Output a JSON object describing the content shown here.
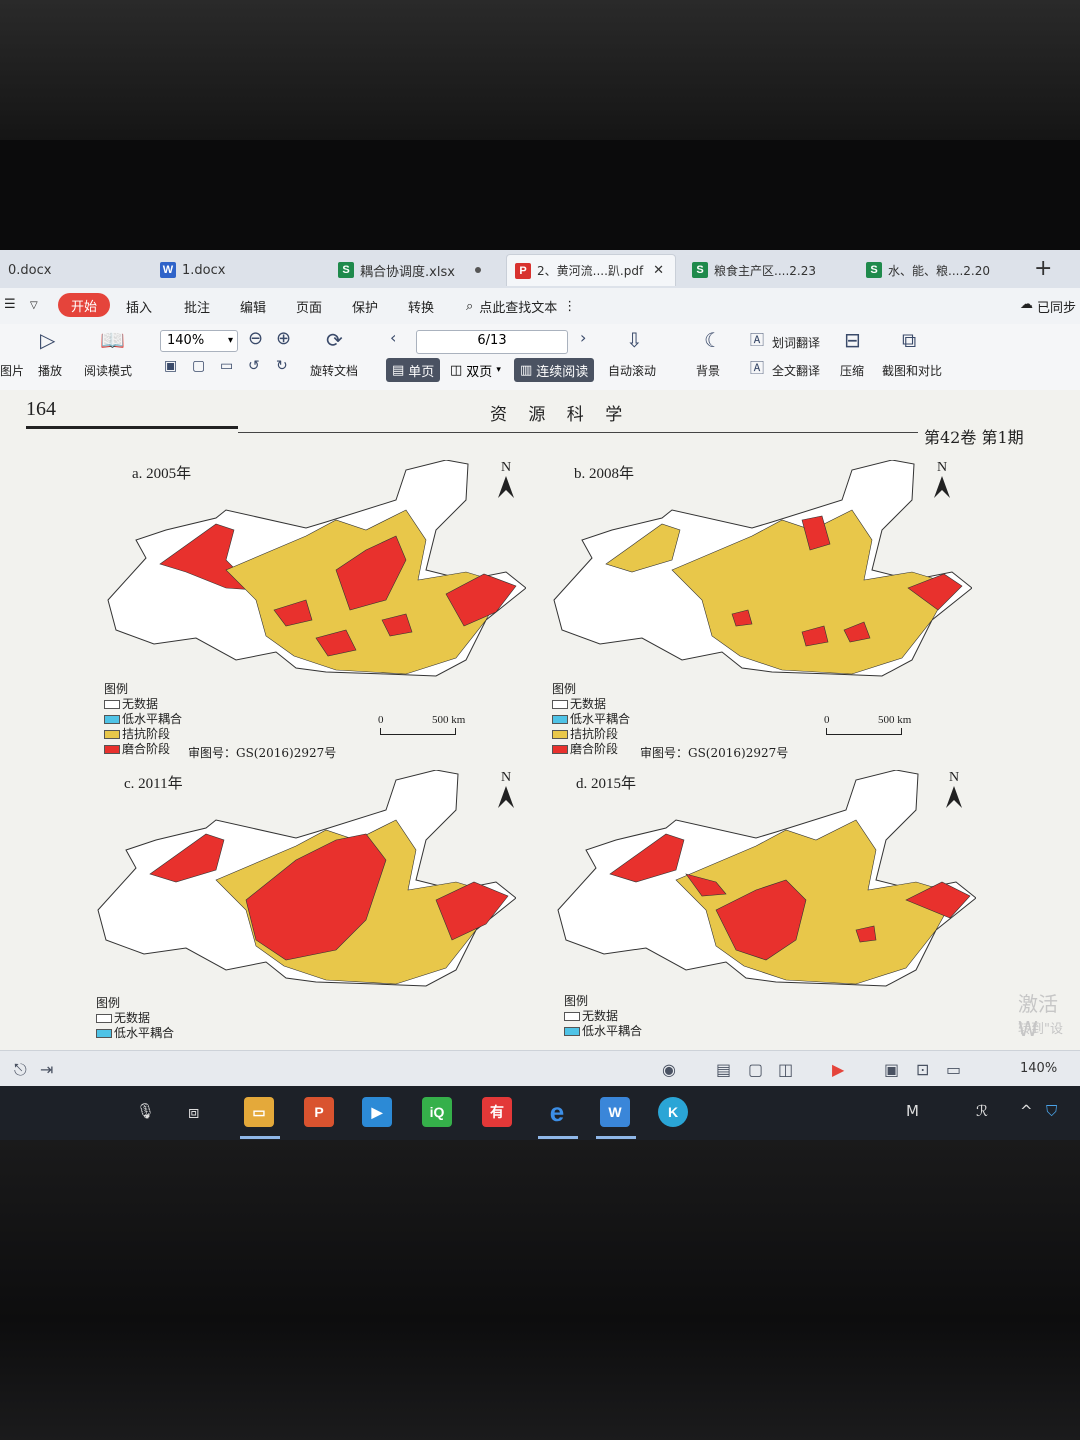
{
  "tabs": [
    {
      "label": "0.docx",
      "type": "w"
    },
    {
      "label": "1.docx",
      "type": "w"
    },
    {
      "label": "耦合协调度.xlsx",
      "type": "s"
    },
    {
      "label": "2、黄河流....趴.pdf",
      "type": "p",
      "active": true
    },
    {
      "label": "粮食主产区....2.23",
      "type": "s"
    },
    {
      "label": "水、能、粮....2.20",
      "type": "s"
    }
  ],
  "menu": {
    "start": "开始",
    "items": [
      "插入",
      "批注",
      "编辑",
      "页面",
      "保护",
      "转换"
    ],
    "search": "点此查找文本",
    "sync": "已同步"
  },
  "ribbon": {
    "left_partial": "图片",
    "play": "播放",
    "read_mode": "阅读模式",
    "zoom": "140%",
    "rotate": "旋转文档",
    "page": "6/13",
    "single": "单页",
    "double": "双页",
    "continuous": "连续阅读",
    "auto_scroll": "自动滚动",
    "background": "背景",
    "word_translate": "划词翻译",
    "full_translate": "全文翻译",
    "compress": "压缩",
    "screenshot": "截图和对比"
  },
  "document": {
    "page_number": "164",
    "journal": "资 源 科 学",
    "issue": "第42卷 第1期",
    "panels": [
      {
        "title": "a. 2005年",
        "north": "N",
        "legend_title": "图例",
        "legend": [
          "无数据",
          "低水平耦合",
          "拮抗阶段",
          "磨合阶段"
        ],
        "scale_zero": "0",
        "scale_label": "500 km",
        "approval": "审图号：GS(2016)2927号"
      },
      {
        "title": "b. 2008年",
        "north": "N",
        "legend_title": "图例",
        "legend": [
          "无数据",
          "低水平耦合",
          "拮抗阶段",
          "磨合阶段"
        ],
        "scale_zero": "0",
        "scale_label": "500 km",
        "approval": "审图号：GS(2016)2927号"
      },
      {
        "title": "c. 2011年",
        "north": "N",
        "legend_title": "图例",
        "legend": [
          "无数据",
          "低水平耦合"
        ]
      },
      {
        "title": "d. 2015年",
        "north": "N",
        "legend_title": "图例",
        "legend": [
          "无数据",
          "低水平耦合"
        ]
      }
    ],
    "watermark": "激活 W",
    "watermark_sub": "转到\"设"
  },
  "colors": {
    "no_data": "#ffffff",
    "low_coupling": "#4fc3e6",
    "antagonism": "#e8c74a",
    "running_in": "#e8312d"
  },
  "statusbar": {
    "zoom": "140%"
  },
  "taskbar": {
    "apps": [
      "explorer",
      "wps-presentation",
      "player",
      "iqiyi",
      "youdao",
      "edge",
      "wps",
      "k-app"
    ]
  }
}
